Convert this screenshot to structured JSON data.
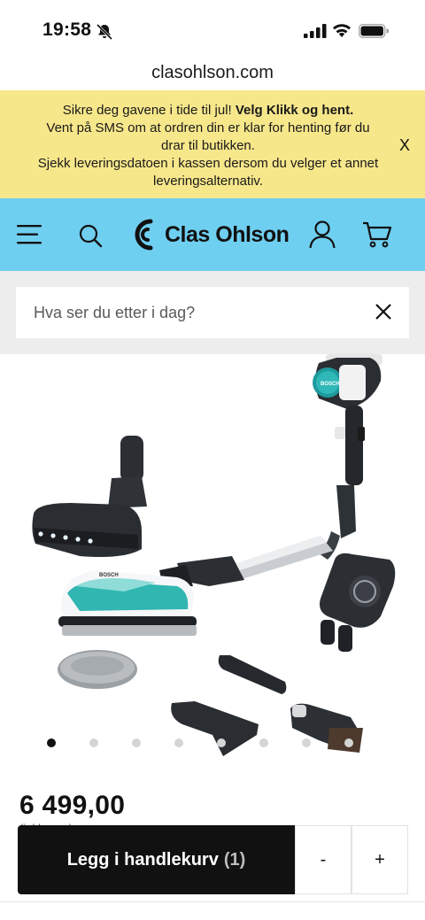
{
  "status_bar": {
    "time": "19:58"
  },
  "url_bar": {
    "domain": "clasohlson.com"
  },
  "banner": {
    "line1_prefix": "Sikre deg gavene i tide til jul! ",
    "line1_bold": "Velg Klikk og hent.",
    "line2": "Vent på SMS om at ordren din er klar for henting før du drar til butikken.",
    "line3": "Sjekk leveringsdatoen i kassen dersom du velger et annet leveringsalternativ.",
    "close_label": "X",
    "color": "#f7e78b"
  },
  "header": {
    "brand": "Clas Ohlson",
    "color": "#6fcff0",
    "icons": [
      "menu-icon",
      "search-icon",
      "account-icon",
      "cart-icon"
    ]
  },
  "search": {
    "placeholder": "Hva ser du etter i dag?"
  },
  "product": {
    "image_alt": "Bosch stick vacuum cleaner with accessories",
    "brand_mark": "BOSCH",
    "carousel": {
      "count": 8,
      "active_index": 0
    },
    "price": "6 499,00",
    "price_note": "(inkl. mva)"
  },
  "cart": {
    "add_label": "Legg i handlekurv",
    "quantity": "(1)",
    "minus_label": "-",
    "plus_label": "+"
  }
}
